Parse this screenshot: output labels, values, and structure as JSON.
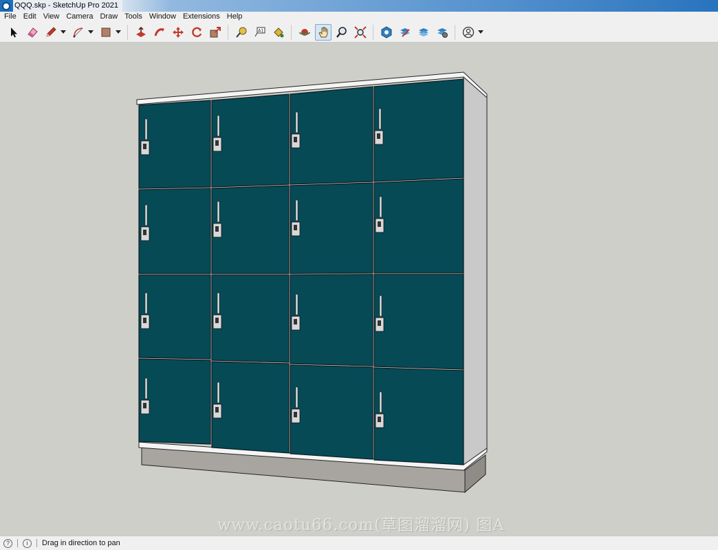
{
  "window": {
    "title": "QQQ.skp - SketchUp Pro 2021"
  },
  "menu": [
    "File",
    "Edit",
    "View",
    "Camera",
    "Draw",
    "Tools",
    "Window",
    "Extensions",
    "Help"
  ],
  "toolbar": {
    "tools": [
      "select-icon",
      "eraser-icon",
      "pencil-icon",
      "arc-icon",
      "rectangle-icon",
      "push-pull-icon",
      "follow-me-icon",
      "move-icon",
      "rotate-icon",
      "scale-icon",
      "tape-measure-icon",
      "text-icon",
      "paint-bucket-icon",
      "orbit-icon",
      "pan-icon",
      "zoom-icon",
      "zoom-extents-icon",
      "warehouse-icon",
      "extension-warehouse-icon",
      "layout-icon",
      "extension-manager-icon",
      "account-icon"
    ],
    "active_tool": "pan-icon"
  },
  "viewport": {
    "background": "#cfcfca",
    "model": {
      "door_color": "#064a56",
      "side_color": "#c9c9c9",
      "base_color": "#a8a49f"
    }
  },
  "watermark": "www.caotu66.com(草图溜溜网) 图A",
  "status": {
    "message": "Drag in direction to pan"
  }
}
